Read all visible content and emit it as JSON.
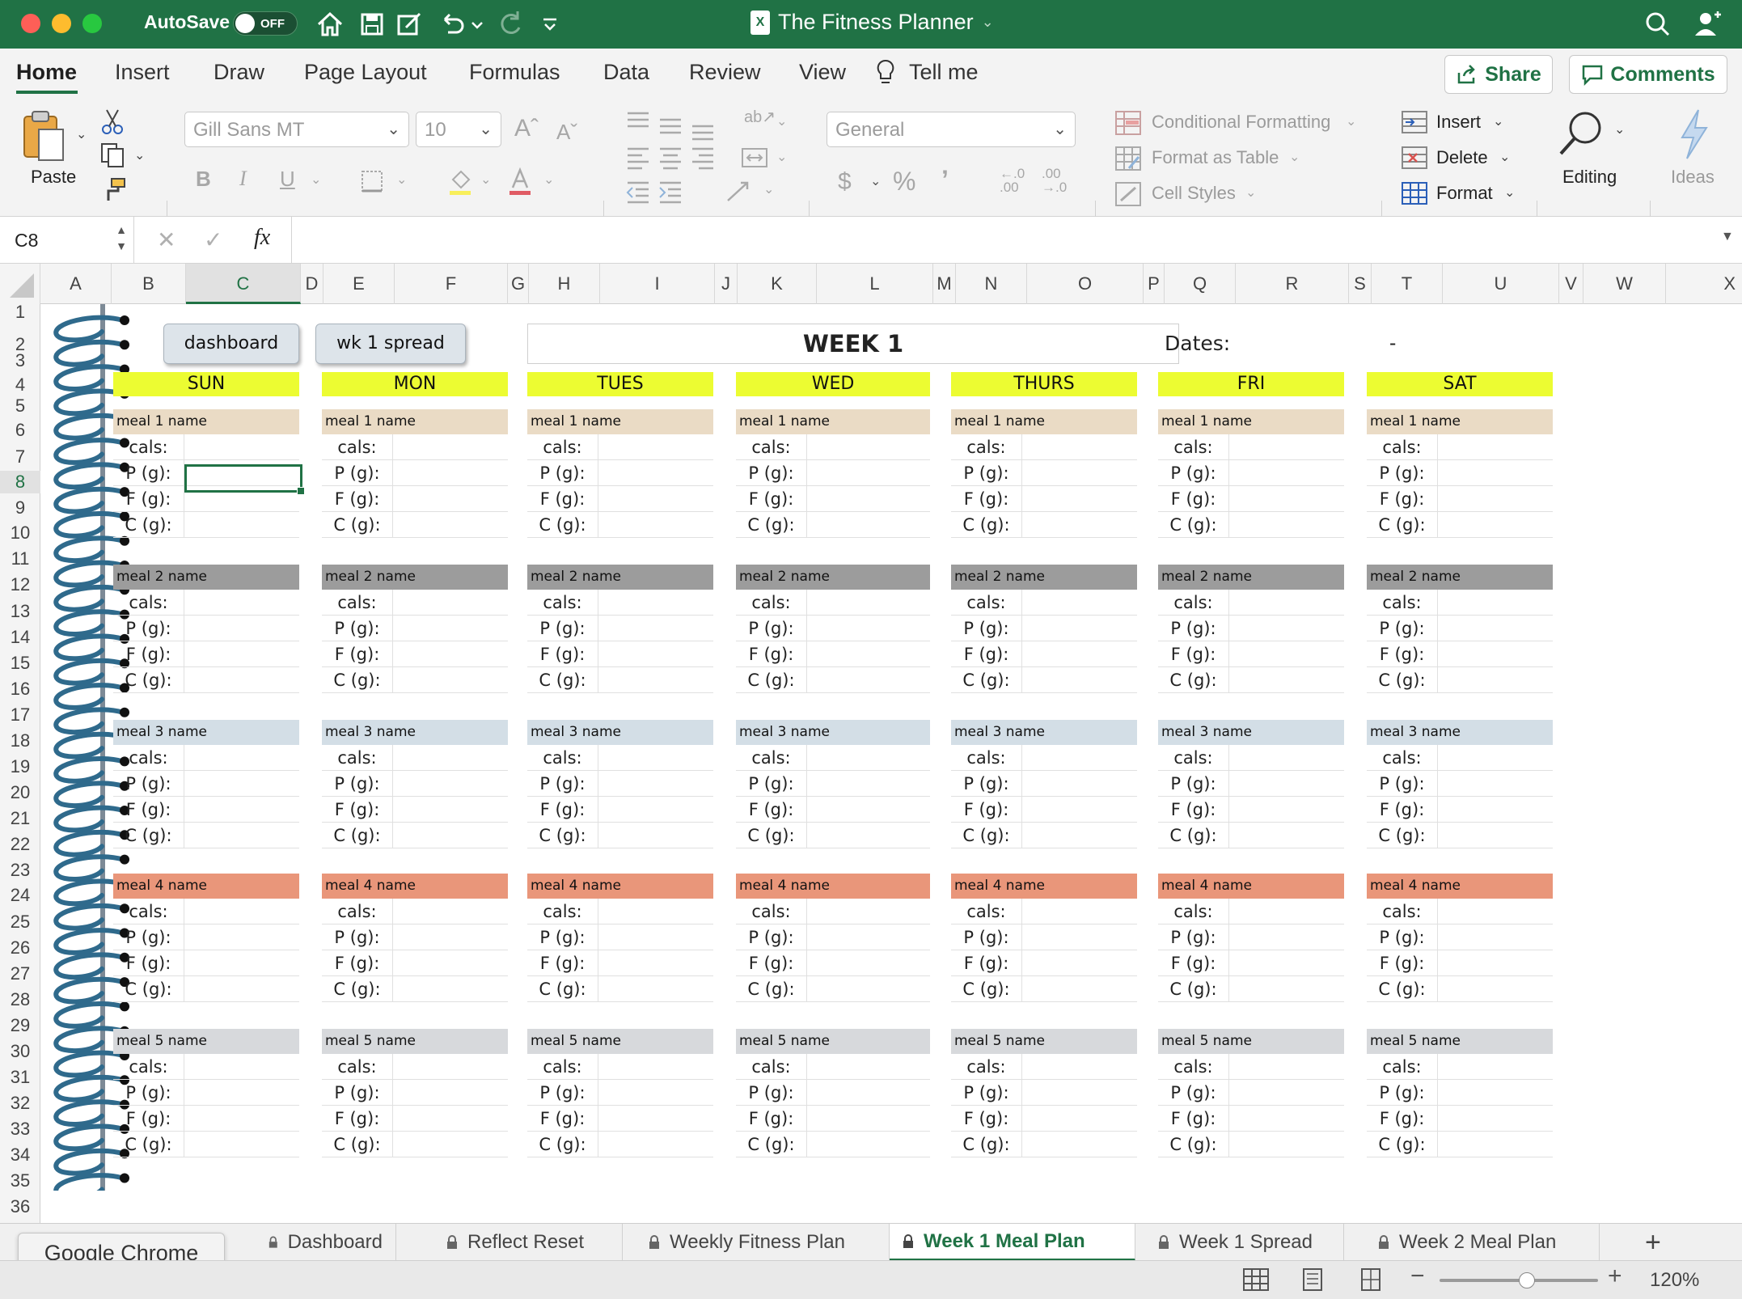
{
  "window": {
    "title": "The Fitness Planner",
    "autosave_label": "AutoSave",
    "autosave_state": "OFF"
  },
  "ribbon_tabs": [
    "Home",
    "Insert",
    "Draw",
    "Page Layout",
    "Formulas",
    "Data",
    "Review",
    "View",
    "Tell me"
  ],
  "share_label": "Share",
  "comments_label": "Comments",
  "ribbon": {
    "paste_label": "Paste",
    "font_name": "Gill Sans MT",
    "font_size": "10",
    "number_format": "General",
    "conditional_formatting": "Conditional Formatting",
    "format_as_table": "Format as Table",
    "cell_styles": "Cell Styles",
    "insert": "Insert",
    "delete": "Delete",
    "format": "Format",
    "editing": "Editing",
    "ideas": "Ideas"
  },
  "formula_bar": {
    "name_box": "C8",
    "fx": "fx",
    "content": ""
  },
  "columns": [
    {
      "label": "A"
    },
    {
      "label": "B"
    },
    {
      "label": "C"
    },
    {
      "label": "D"
    },
    {
      "label": "E"
    },
    {
      "label": "F"
    },
    {
      "label": "G"
    },
    {
      "label": "H"
    },
    {
      "label": "I"
    },
    {
      "label": "J"
    },
    {
      "label": "K"
    },
    {
      "label": "L"
    },
    {
      "label": "M"
    },
    {
      "label": "N"
    },
    {
      "label": "O"
    },
    {
      "label": "P"
    },
    {
      "label": "Q"
    },
    {
      "label": "R"
    },
    {
      "label": "S"
    },
    {
      "label": "T"
    },
    {
      "label": "U"
    },
    {
      "label": "V"
    },
    {
      "label": "W"
    },
    {
      "label": "X"
    }
  ],
  "selected_column": "C",
  "selected_row": "8",
  "rows": [
    "1",
    "2",
    "3",
    "4",
    "5",
    "6",
    "7",
    "8",
    "9",
    "10",
    "11",
    "12",
    "13",
    "14",
    "15",
    "16",
    "17",
    "18",
    "19",
    "20",
    "21",
    "22",
    "23",
    "24",
    "25",
    "26",
    "27",
    "28",
    "29",
    "30",
    "31",
    "32",
    "33",
    "34",
    "35",
    "36"
  ],
  "sheet": {
    "buttons": [
      "dashboard",
      "wk 1 spread"
    ],
    "week_title": "WEEK 1",
    "dates_label": "Dates:",
    "dates_value": "-",
    "days": [
      "SUN",
      "MON",
      "TUES",
      "WED",
      "THURS",
      "FRI",
      "SAT"
    ],
    "meals": [
      "meal 1 name",
      "meal 2 name",
      "meal 3 name",
      "meal 4 name",
      "meal 5 name"
    ],
    "row_labels": [
      "cals:",
      "P (g):",
      "F (g):",
      "C (g):"
    ],
    "meal_colors": [
      "#eadbc5",
      "#9c9c9c",
      "#d3dee6",
      "#e9967a",
      "#d7d9dc"
    ],
    "day_header_color": "#ecfc32"
  },
  "sheet_tabs": [
    {
      "label": "Dashboard",
      "active": false
    },
    {
      "label": "Reflect Reset",
      "active": false
    },
    {
      "label": "Weekly Fitness Plan",
      "active": false
    },
    {
      "label": "Week 1 Meal Plan",
      "active": true
    },
    {
      "label": "Week 1 Spread",
      "active": false
    },
    {
      "label": "Week 2 Meal Plan",
      "active": false
    }
  ],
  "tooltip": "Google Chrome",
  "zoom": "120%",
  "accent_color": "#207245"
}
